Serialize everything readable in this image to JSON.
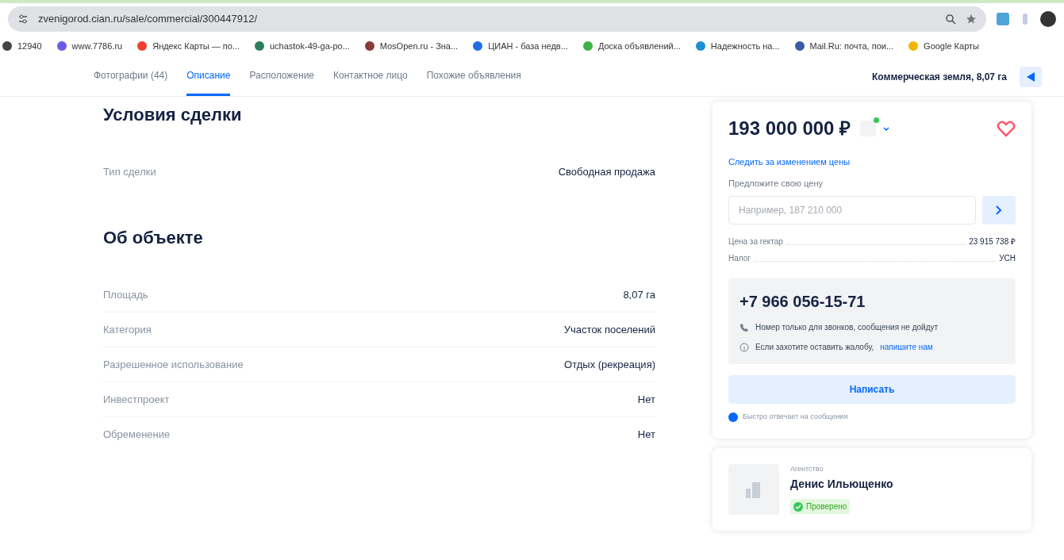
{
  "browser": {
    "url": "zvenigorod.cian.ru/sale/commercial/300447912/",
    "bookmarks": [
      {
        "label": "12940",
        "color": "#444444"
      },
      {
        "label": "www.7786.ru",
        "color": "#6b5ce7"
      },
      {
        "label": "Яндекс Карты — по...",
        "color": "#f03e2e"
      },
      {
        "label": "uchastok-49-ga-po...",
        "color": "#2e7d5b"
      },
      {
        "label": "MosOpen.ru - Зна...",
        "color": "#8b3a3a"
      },
      {
        "label": "ЦИАН - база недв...",
        "color": "#1f6fe5"
      },
      {
        "label": "Доска объявлений...",
        "color": "#3cb34a"
      },
      {
        "label": "Надежность на...",
        "color": "#1a8fd6"
      },
      {
        "label": "Mail.Ru: почта, пои...",
        "color": "#3b5aa8"
      },
      {
        "label": "Google Карты",
        "color": "#f2b500"
      }
    ]
  },
  "nav": {
    "tabs": [
      {
        "label": "Фотографии (44)",
        "selected": false
      },
      {
        "label": "Описание",
        "selected": true
      },
      {
        "label": "Расположение",
        "selected": false
      },
      {
        "label": "Контактное лицо",
        "selected": false
      },
      {
        "label": "Похожие объявления",
        "selected": false
      }
    ],
    "title": "Коммерческая земля, 8,07 га"
  },
  "sections": [
    {
      "title": "Условия сделки",
      "rows": [
        {
          "label": "Тип сделки",
          "value": "Свободная продажа"
        }
      ]
    },
    {
      "title": "Об объекте",
      "rows": [
        {
          "label": "Площадь",
          "value": "8,07 га"
        },
        {
          "label": "Категория",
          "value": "Участок поселений"
        },
        {
          "label": "Разрешенное использование",
          "value": "Отдых (рекреация)"
        },
        {
          "label": "Инвестпроект",
          "value": "Нет"
        },
        {
          "label": "Обременение",
          "value": "Нет"
        }
      ]
    }
  ],
  "price_card": {
    "price": "193 000 000 ₽",
    "watch_link": "Следить за изменением цены",
    "offer_label": "Предложите свою цену",
    "offer_placeholder": "Например, 187 210 000",
    "facts": [
      {
        "label": "Цена за гектар",
        "value": "23 915 738 ₽"
      },
      {
        "label": "Налог",
        "value": "УСН"
      }
    ],
    "phone": "+7 966 056-15-71",
    "notes": [
      {
        "kind": "phone",
        "text": "Номер только для звонков, сообщения не дойдут"
      },
      {
        "kind": "complaint",
        "text": "Если захотите оставить жалобу,",
        "link": "напишите нам"
      }
    ],
    "write_button": "Написать",
    "fast_reply": "Быстро отвечает на сообщения"
  },
  "agent": {
    "role": "Агентство",
    "name": "Денис Ильющенко",
    "badge": "Проверено"
  }
}
